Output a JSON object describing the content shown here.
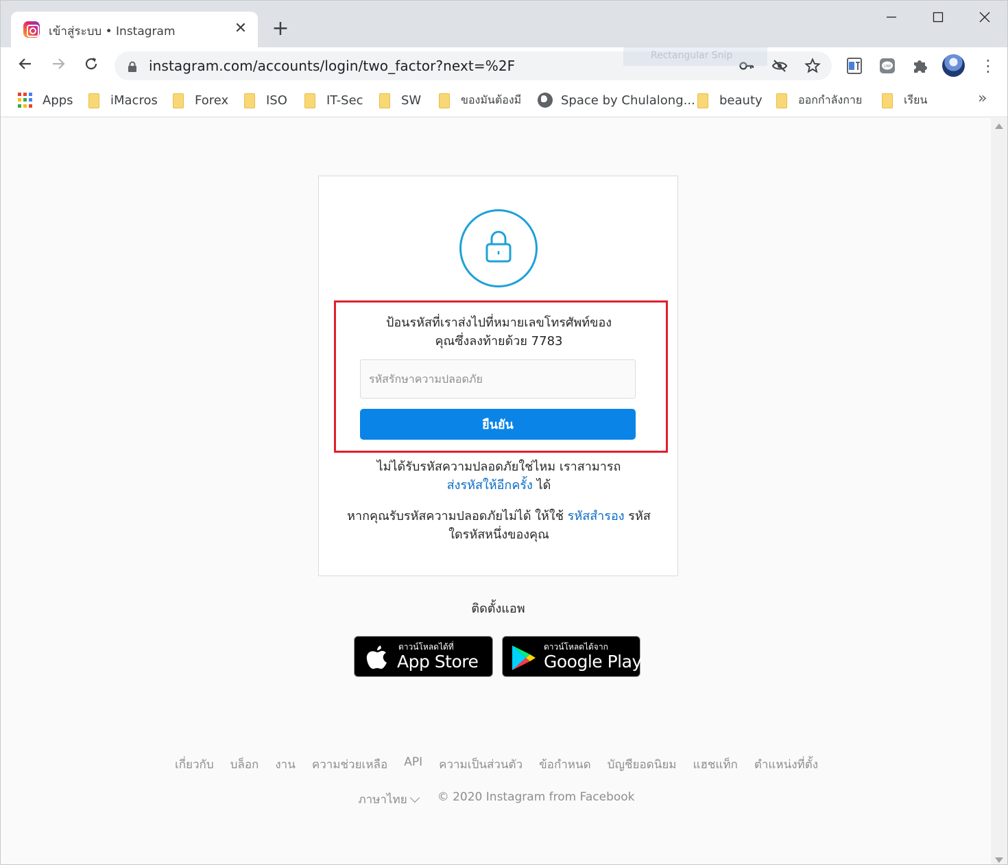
{
  "browser": {
    "tab": {
      "title": "เข้าสู่ระบบ • Instagram",
      "close": "✕"
    },
    "new_tab": "+",
    "url": "instagram.com/accounts/login/two_factor?next=%2F",
    "ghost_overlay": "Rectangular Snip",
    "bookmarks": [
      {
        "label": "Apps",
        "type": "apps"
      },
      {
        "label": "iMacros",
        "type": "folder"
      },
      {
        "label": "Forex",
        "type": "folder"
      },
      {
        "label": "ISO",
        "type": "folder"
      },
      {
        "label": "IT-Sec",
        "type": "folder"
      },
      {
        "label": "SW",
        "type": "folder"
      },
      {
        "label": "ของมันต้องมี",
        "type": "folder"
      },
      {
        "label": "Space by Chulalong...",
        "type": "globe"
      },
      {
        "label": "beauty",
        "type": "folder"
      },
      {
        "label": "ออกกำลังกาย",
        "type": "folder"
      },
      {
        "label": "เรียน",
        "type": "folder"
      }
    ],
    "bookmarks_more": "»"
  },
  "two_factor": {
    "instruction_line1": "ป้อนรหัสที่เราส่งไปที่หมายเลขโทรศัพท์ของ",
    "instruction_line2": "คุณซึ่งลงท้ายด้วย 7783",
    "code_input_placeholder": "รหัสรักษาความปลอดภัย",
    "confirm_label": "ยืนยัน",
    "resend_prefix": "ไม่ได้รับรหัสความปลอดภัยใช่ไหม เราสามารถ",
    "resend_link": "ส่งรหัสให้อีกครั้ง",
    "resend_suffix": "ได้",
    "backup_prefix": "หากคุณรับรหัสความปลอดภัยไม่ได้ ให้ใช้",
    "backup_link": "รหัสสำรอง",
    "backup_suffix": "รหัสใดรหัสหนึ่งของคุณ"
  },
  "install": {
    "label": "ติดตั้งแอพ",
    "app_store": {
      "small": "ดาวน์โหลดได้ที่",
      "big": "App Store"
    },
    "google_play": {
      "small": "ดาวน์โหลดได้จาก",
      "big": "Google Play"
    }
  },
  "footer": {
    "links": [
      "เกี่ยวกับ",
      "บล็อก",
      "งาน",
      "ความช่วยเหลือ",
      "API",
      "ความเป็นส่วนตัว",
      "ข้อกำหนด",
      "บัญชียอดนิยม",
      "แฮชแท็ก",
      "ตำแหน่งที่ตั้ง"
    ],
    "language": "ภาษาไทย",
    "copyright": "© 2020 Instagram from Facebook"
  },
  "colors": {
    "accent_blue": "#0a84e6",
    "link_blue": "#0a6bc7",
    "highlight_red": "#e0202b",
    "lock_blue": "#1ea0d8"
  }
}
